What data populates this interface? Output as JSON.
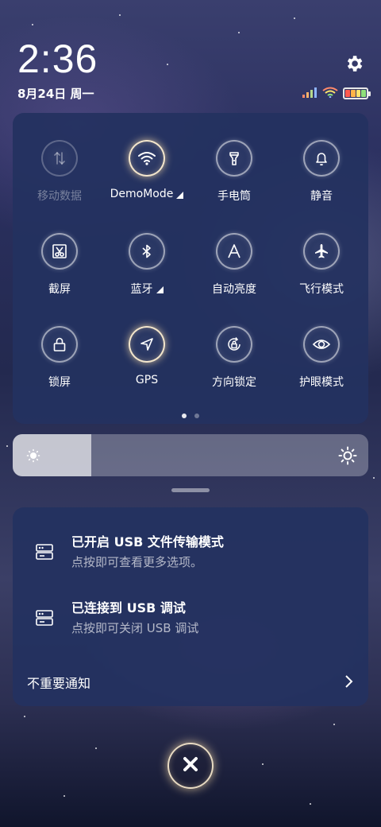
{
  "status": {
    "time": "2:36",
    "date": "8月24日 周一",
    "icons": [
      "signal-icon",
      "wifi-icon",
      "battery-icon"
    ],
    "battery_colors": [
      "#ff5a4e",
      "#ffb347",
      "#ffe36b",
      "#8fe07a"
    ]
  },
  "quick_settings": {
    "tiles": [
      {
        "label": "移动数据",
        "icon": "mobile-data-icon",
        "state": "disabled"
      },
      {
        "label": "DemoMode",
        "icon": "wifi-icon",
        "state": "active",
        "expandable": true
      },
      {
        "label": "手电筒",
        "icon": "flashlight-icon",
        "state": "off"
      },
      {
        "label": "静音",
        "icon": "bell-icon",
        "state": "off"
      },
      {
        "label": "截屏",
        "icon": "screenshot-icon",
        "state": "off"
      },
      {
        "label": "蓝牙",
        "icon": "bluetooth-icon",
        "state": "off",
        "expandable": true
      },
      {
        "label": "自动亮度",
        "icon": "auto-brightness-icon",
        "state": "off"
      },
      {
        "label": "飞行模式",
        "icon": "airplane-icon",
        "state": "off"
      },
      {
        "label": "锁屏",
        "icon": "lock-icon",
        "state": "off"
      },
      {
        "label": "GPS",
        "icon": "location-arrow-icon",
        "state": "active"
      },
      {
        "label": "方向锁定",
        "icon": "rotation-lock-icon",
        "state": "off"
      },
      {
        "label": "护眼模式",
        "icon": "eye-icon",
        "state": "off"
      }
    ],
    "page_count": 2,
    "current_page": 1
  },
  "brightness": {
    "level_percent": 22
  },
  "notifications": [
    {
      "title": "已开启 USB 文件传输模式",
      "text": "点按即可查看更多选项。",
      "icon": "usb-settings-icon"
    },
    {
      "title": "已连接到 USB 调试",
      "text": "点按即可关闭 USB 调试",
      "icon": "usb-settings-icon"
    }
  ],
  "unimportant_label": "不重要通知",
  "colors": {
    "panel": "#243260",
    "accent_glow": "#ffe1aa"
  }
}
